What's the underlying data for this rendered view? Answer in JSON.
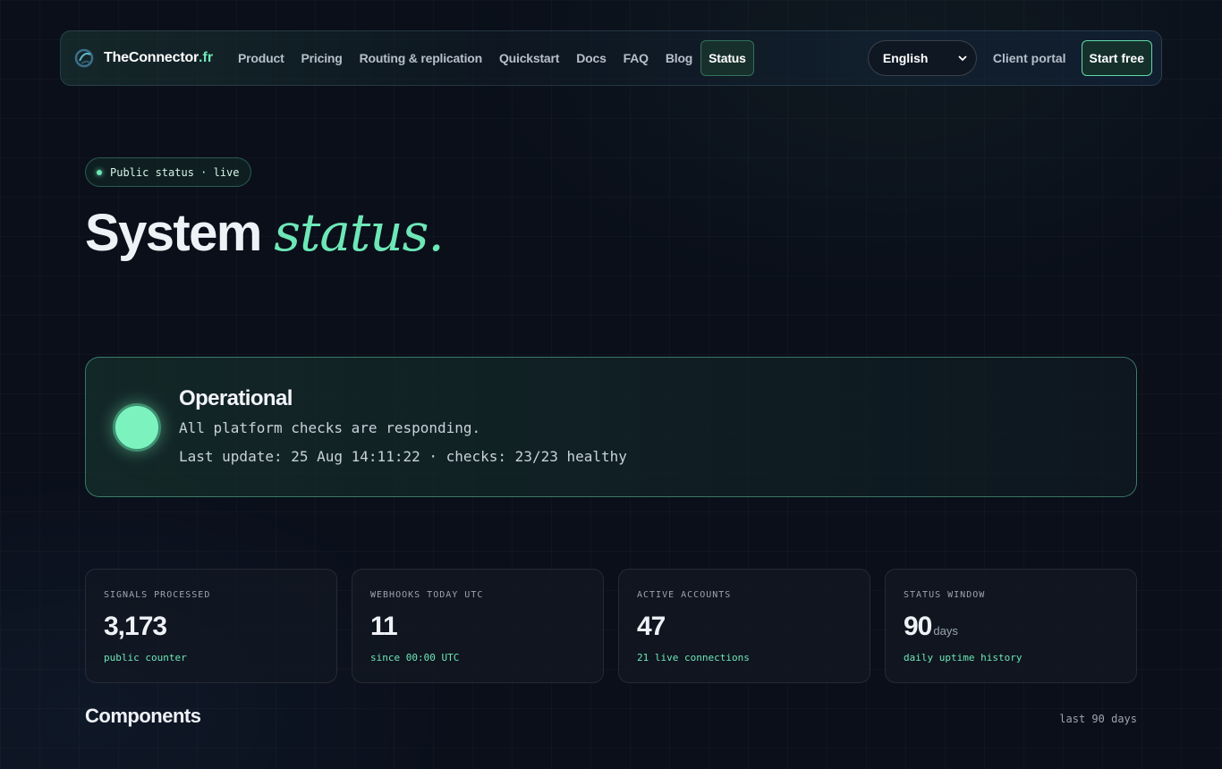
{
  "nav": {
    "brand_name": "TheConnector",
    "brand_tld": ".fr",
    "items": [
      {
        "label": "Product"
      },
      {
        "label": "Pricing"
      },
      {
        "label": "Routing & replication"
      },
      {
        "label": "Quickstart"
      },
      {
        "label": "Docs"
      },
      {
        "label": "FAQ"
      },
      {
        "label": "Blog"
      },
      {
        "label": "Status",
        "active": true
      }
    ],
    "language": "English",
    "portal_label": "Client portal",
    "start_label": "Start free"
  },
  "hero": {
    "pill_text": "Public status · live",
    "title_main": "System ",
    "title_accent": "status."
  },
  "status": {
    "title": "Operational",
    "description": "All platform checks are responding.",
    "meta": "Last update: 25 Aug 14:11:22 · checks: 23/23 healthy",
    "color": "#7cf3bf"
  },
  "stats": [
    {
      "label": "SIGNALS PROCESSED",
      "value": "3,173",
      "unit": "",
      "note": "public counter"
    },
    {
      "label": "WEBHOOKS TODAY UTC",
      "value": "11",
      "unit": "",
      "note": "since 00:00 UTC"
    },
    {
      "label": "ACTIVE ACCOUNTS",
      "value": "47",
      "unit": "",
      "note": "21 live connections"
    },
    {
      "label": "STATUS WINDOW",
      "value": "90",
      "unit": "days",
      "note": "daily uptime history"
    }
  ],
  "components": {
    "title": "Components",
    "range": "last 90 days"
  },
  "colors": {
    "accent": "#6ee7b7",
    "background": "#0a0f1a"
  }
}
